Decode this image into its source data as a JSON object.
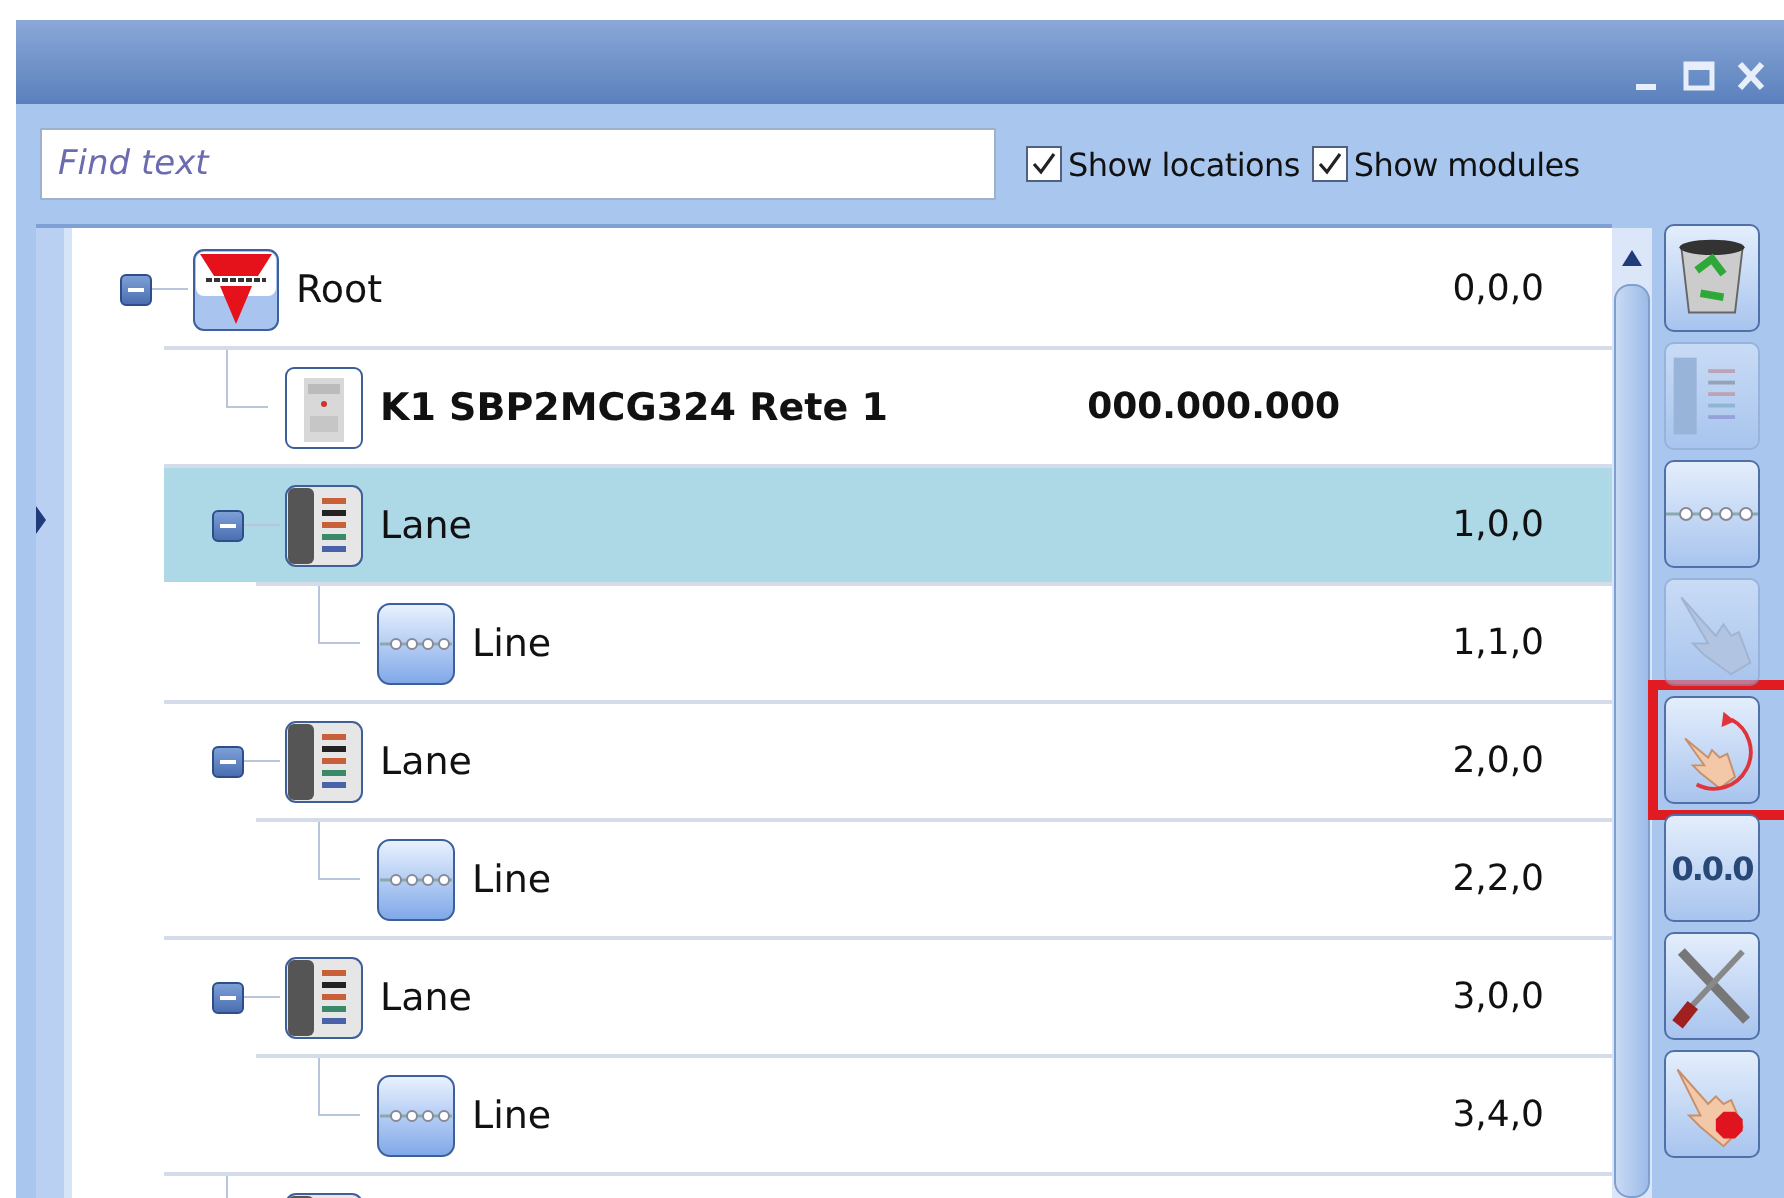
{
  "window": {
    "controls": [
      {
        "kind": "minimize"
      },
      {
        "kind": "maximize"
      },
      {
        "kind": "close"
      }
    ]
  },
  "search": {
    "placeholder": "Find text"
  },
  "options": [
    {
      "label": "Show locations",
      "checked": true
    },
    {
      "label": "Show modules",
      "checked": true
    }
  ],
  "tree": [
    {
      "kind": "root",
      "label": "Root",
      "address": "0,0,0",
      "expanded": true,
      "selected": false,
      "children": [
        {
          "kind": "module",
          "label": "K1 SBP2MCG324 Rete 1",
          "address": "000.000.000",
          "selected": false
        },
        {
          "kind": "lane",
          "label": "Lane",
          "address": "1,0,0",
          "expanded": true,
          "selected": true,
          "children": [
            {
              "kind": "line",
              "label": "Line",
              "address": "1,1,0",
              "selected": false
            }
          ]
        },
        {
          "kind": "lane",
          "label": "Lane",
          "address": "2,0,0",
          "expanded": true,
          "selected": false,
          "children": [
            {
              "kind": "line",
              "label": "Line",
              "address": "2,2,0",
              "selected": false
            }
          ]
        },
        {
          "kind": "lane",
          "label": "Lane",
          "address": "3,0,0",
          "expanded": true,
          "selected": false,
          "children": [
            {
              "kind": "line",
              "label": "Line",
              "address": "3,4,0",
              "selected": false
            }
          ]
        },
        {
          "kind": "lane",
          "selected": false
        }
      ]
    }
  ],
  "toolbar": [
    {
      "kind": "recycle",
      "disabled": false,
      "highlighted": false
    },
    {
      "kind": "lane",
      "disabled": true,
      "highlighted": false
    },
    {
      "kind": "line",
      "disabled": false,
      "highlighted": false
    },
    {
      "kind": "hand",
      "disabled": true,
      "highlighted": false
    },
    {
      "kind": "hand-rotate",
      "disabled": false,
      "highlighted": true
    },
    {
      "kind": "address",
      "label": "0.0.0",
      "disabled": false,
      "highlighted": false
    },
    {
      "kind": "tools",
      "disabled": false,
      "highlighted": false
    },
    {
      "kind": "hand-stop",
      "disabled": false,
      "highlighted": false
    }
  ]
}
